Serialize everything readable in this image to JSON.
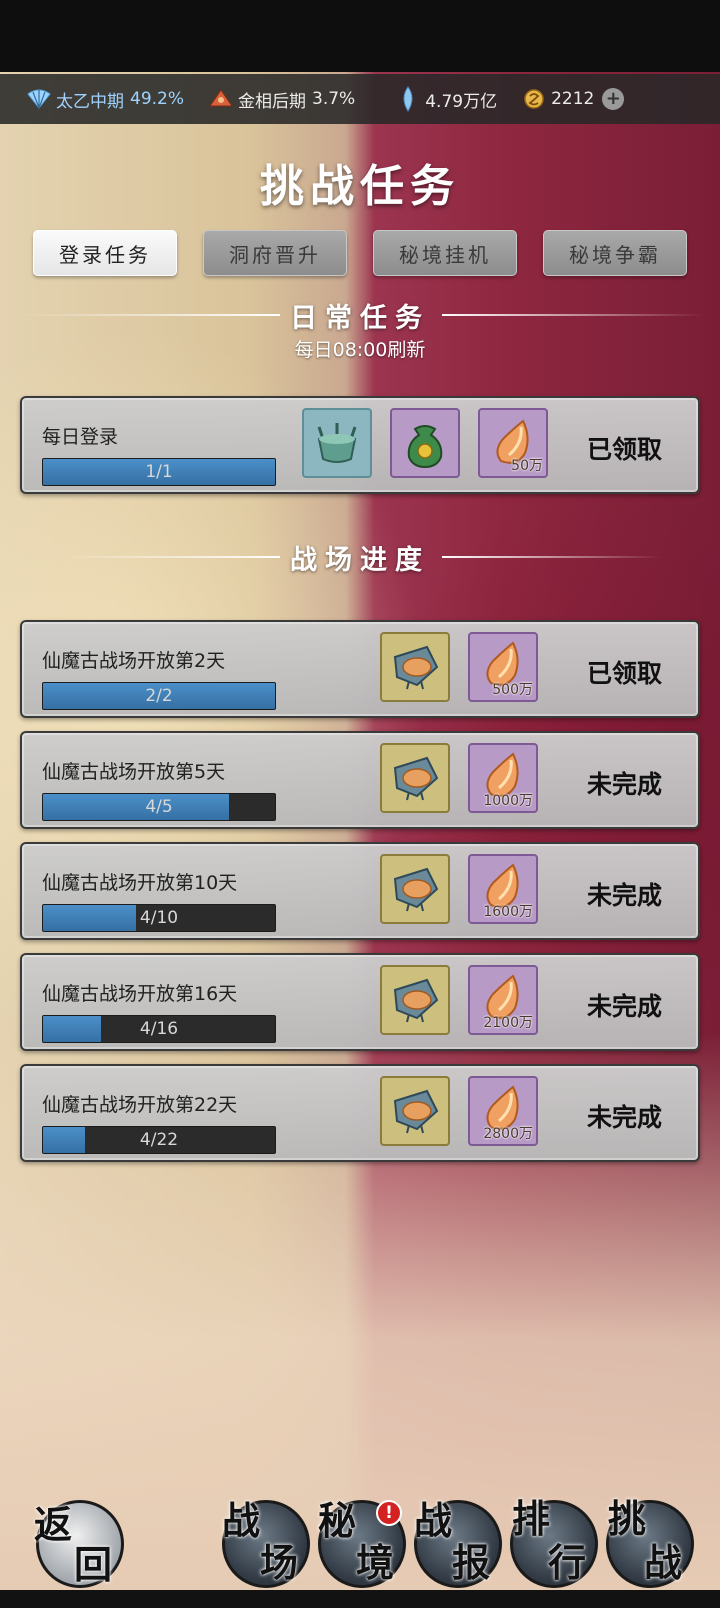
{
  "status_bar": {
    "realm1": {
      "label": "太乙中期",
      "pct": "49.2%",
      "icon": "fan-icon"
    },
    "realm2": {
      "label": "金相后期",
      "pct": "3.7%",
      "icon": "bell-icon"
    },
    "crystal": {
      "value": "4.79万亿",
      "icon": "crystal-icon"
    },
    "coin": {
      "value": "2212",
      "icon": "coin-icon"
    },
    "add_icon": "plus-icon"
  },
  "page_title": "挑战任务",
  "tabs": [
    {
      "label": "登录任务",
      "active": true
    },
    {
      "label": "洞府晋升",
      "active": false
    },
    {
      "label": "秘境挂机",
      "active": false
    },
    {
      "label": "秘境争霸",
      "active": false
    }
  ],
  "daily": {
    "heading": "日常任务",
    "refresh": "每日08:00刷新",
    "task": {
      "title": "每日登录",
      "progress_text": "1/1",
      "progress": 1.0,
      "status": "已领取",
      "rewards": [
        {
          "icon": "cauldron-icon",
          "count": ""
        },
        {
          "icon": "pouch-icon",
          "count": ""
        },
        {
          "icon": "spirit-stone-icon",
          "count": "50万"
        }
      ]
    }
  },
  "battle": {
    "heading": "战场进度",
    "tasks": [
      {
        "title": "仙魔古战场开放第2天",
        "progress_text": "2/2",
        "progress": 1.0,
        "status": "已领取",
        "reward_count": "500万"
      },
      {
        "title": "仙魔古战场开放第5天",
        "progress_text": "4/5",
        "progress": 0.8,
        "status": "未完成",
        "reward_count": "1000万"
      },
      {
        "title": "仙魔古战场开放第10天",
        "progress_text": "4/10",
        "progress": 0.4,
        "status": "未完成",
        "reward_count": "1600万"
      },
      {
        "title": "仙魔古战场开放第16天",
        "progress_text": "4/16",
        "progress": 0.25,
        "status": "未完成",
        "reward_count": "2100万"
      },
      {
        "title": "仙魔古战场开放第22天",
        "progress_text": "4/22",
        "progress": 0.18,
        "status": "未完成",
        "reward_count": "2800万"
      }
    ]
  },
  "nav": {
    "back": {
      "line1": "返",
      "line2": "回"
    },
    "items": [
      {
        "line1": "战",
        "line2": "场",
        "badge": ""
      },
      {
        "line1": "秘",
        "line2": "境",
        "badge": "!"
      },
      {
        "line1": "战",
        "line2": "报",
        "badge": ""
      },
      {
        "line1": "排",
        "line2": "行",
        "badge": ""
      },
      {
        "line1": "挑",
        "line2": "战",
        "badge": ""
      }
    ]
  }
}
